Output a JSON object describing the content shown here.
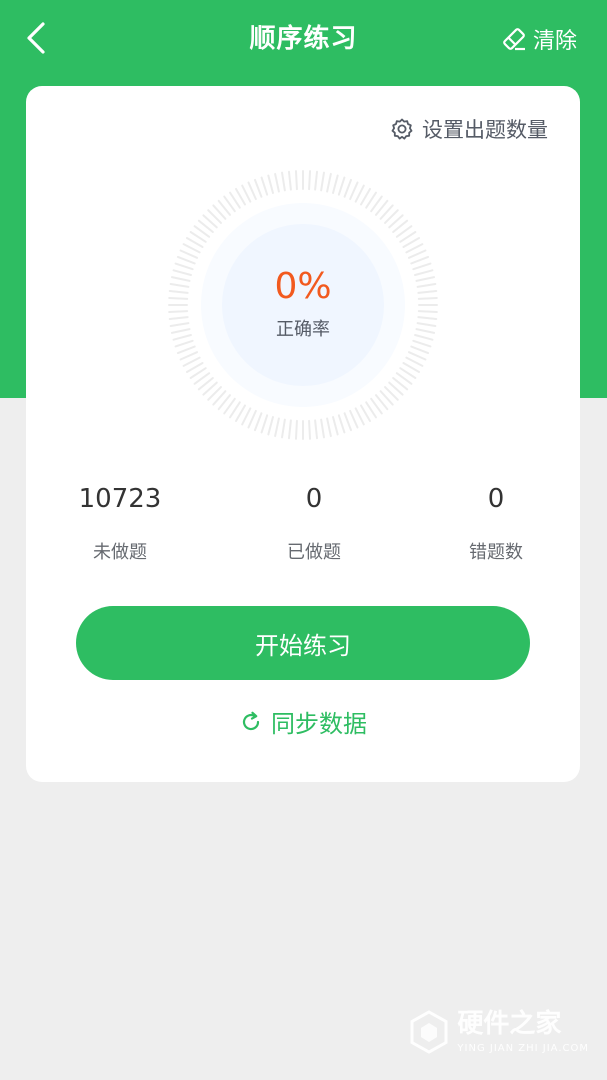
{
  "header": {
    "title": "顺序练习",
    "back_icon": "chevron-left-icon",
    "clear_label": "清除",
    "clear_icon": "eraser-icon"
  },
  "card": {
    "settings": {
      "label": "设置出题数量",
      "icon": "gear-icon"
    },
    "accuracy": {
      "value": "0%",
      "label": "正确率"
    },
    "stats": [
      {
        "value": "10723",
        "label": "未做题"
      },
      {
        "value": "0",
        "label": "已做题"
      },
      {
        "value": "0",
        "label": "错题数"
      }
    ],
    "start_button": "开始练习",
    "sync": {
      "label": "同步数据",
      "icon": "refresh-icon"
    }
  },
  "watermark": {
    "brand": "硬件之家",
    "sub": "YING JIAN ZHI JIA.COM"
  },
  "colors": {
    "primary": "#2ebd62",
    "accent": "#f25a1f",
    "background": "#eeeeee",
    "dial_center": "#f0f6ff"
  }
}
